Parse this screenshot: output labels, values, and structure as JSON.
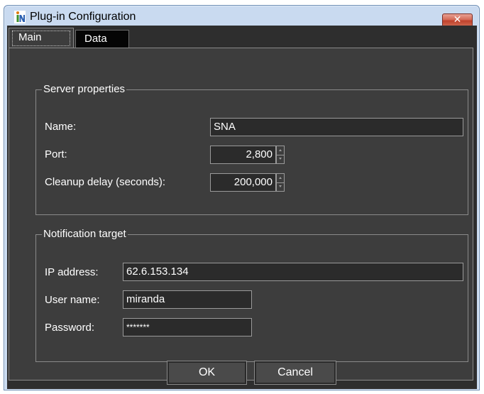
{
  "window": {
    "title": "Plug-in Configuration",
    "close_glyph": "✕",
    "icon": "iN-logo-icon"
  },
  "tabs": [
    {
      "label": "Main",
      "selected": true
    },
    {
      "label": "Data",
      "selected": false
    }
  ],
  "server_properties": {
    "title": "Server properties",
    "name_label": "Name:",
    "name_value": "SNA",
    "port_label": "Port:",
    "port_value": "2,800",
    "cleanup_label": "Cleanup delay (seconds):",
    "cleanup_value": "200,000"
  },
  "notification_target": {
    "title": "Notification target",
    "ip_label": "IP address:",
    "ip_value": "62.6.153.134",
    "user_label": "User name:",
    "user_value": "miranda",
    "password_label": "Password:",
    "password_value": "*******"
  },
  "buttons": {
    "ok": "OK",
    "cancel": "Cancel"
  },
  "colors": {
    "dialog_background": "#3d3d3d",
    "field_background": "#2b2b2b",
    "text": "#ffffff",
    "window_frame": "#c9daf0",
    "close_button": "#c0422c"
  }
}
